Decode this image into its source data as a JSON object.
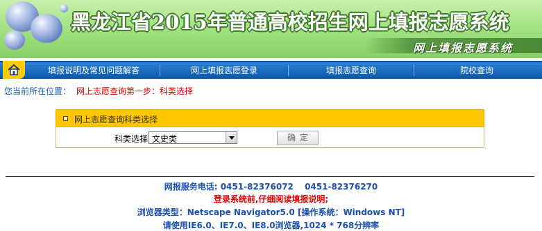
{
  "banner": {
    "title": "黑龙江省2015年普通高校招生网上填报志愿系统",
    "subtitle": "网上填报志愿系统"
  },
  "nav": {
    "home_icon": "home-icon",
    "items": [
      {
        "label": "填报说明及常见问题解答"
      },
      {
        "label": "网上填报志愿登录"
      },
      {
        "label": "填报志愿查询"
      },
      {
        "label": "院校查询"
      }
    ]
  },
  "location": {
    "label": "您当前所在位置：",
    "value": "网上志愿查询第一步：科类选择"
  },
  "form": {
    "heading": "网上志愿查询科类选择",
    "select_label": "科类选择",
    "select_value": "文史类",
    "confirm_label": "确定"
  },
  "footer": {
    "phone_line": "网报服务电话: 0451-82376072　 0451-82376270",
    "notice": "登录系统前,仔细阅读填报说明;",
    "browser_line": "浏览器类型：Netscape Navigator5.0 [操作系统：Windows NT]",
    "requirement": "请使用IE6.0、IE7.0、IE8.0浏览器,1024 * 768分辨率"
  },
  "colors": {
    "banner_green": "#a4e283",
    "nav_blue": "#0e5cb0",
    "accent_yellow": "#ffc600",
    "alert_red": "#e60000",
    "link_blue": "#1a50b0"
  }
}
